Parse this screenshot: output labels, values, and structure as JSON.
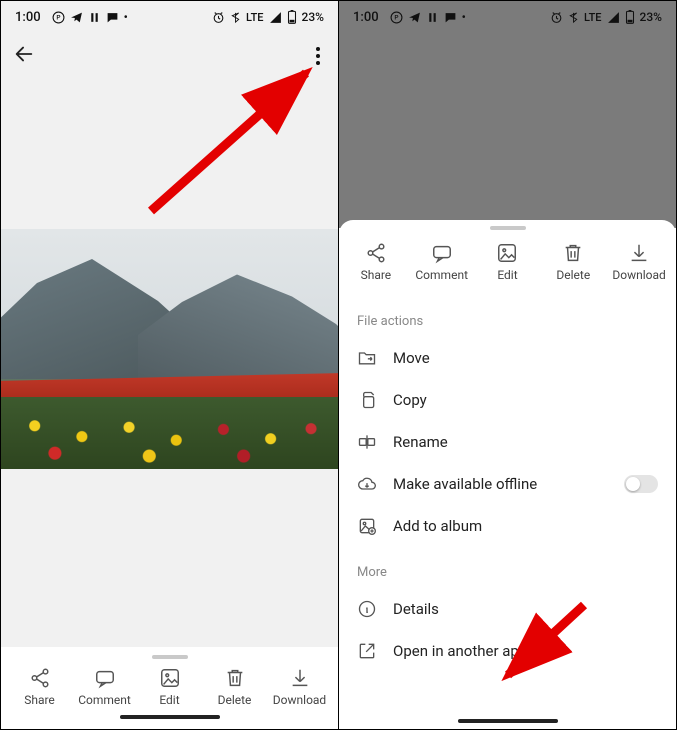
{
  "status": {
    "time": "1:00",
    "lte": "LTE",
    "battery": "23%"
  },
  "actions": {
    "share": "Share",
    "comment": "Comment",
    "edit": "Edit",
    "delete": "Delete",
    "download": "Download"
  },
  "sheet": {
    "section1": "File actions",
    "move": "Move",
    "copy": "Copy",
    "rename": "Rename",
    "offline": "Make available offline",
    "add_album": "Add to album",
    "section2": "More",
    "details": "Details",
    "open_other": "Open in another app"
  }
}
